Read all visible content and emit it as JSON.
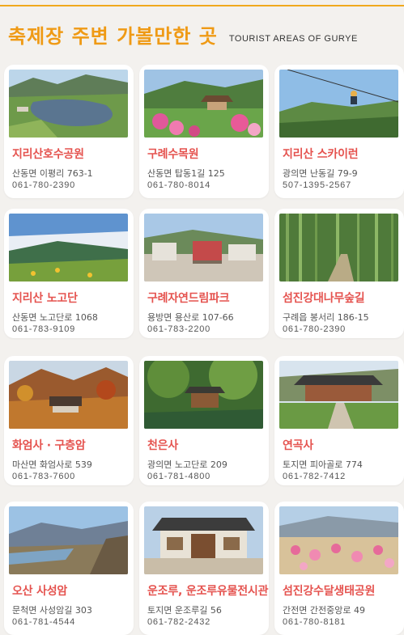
{
  "header": {
    "title": "축제장 주변 가볼만한 곳",
    "subtitle": "TOURIST AREAS OF GURYE"
  },
  "places": [
    {
      "name": "지리산호수공원",
      "address": "산동면 이평리 763-1",
      "phone": "061-780-2390"
    },
    {
      "name": "구례수목원",
      "address": "산동면 탑동1길 125",
      "phone": "061-780-8014"
    },
    {
      "name": "지리산 스카이런",
      "address": "광의면 난동길 79-9",
      "phone": "507-1395-2567"
    },
    {
      "name": "지리산 노고단",
      "address": "산동면 노고단로 1068",
      "phone": "061-783-9109"
    },
    {
      "name": "구례자연드림파크",
      "address": "용방면 용산로 107-66",
      "phone": "061-783-2200"
    },
    {
      "name": "섬진강대나무숲길",
      "address": "구례읍 봉서리 186-15",
      "phone": "061-780-2390"
    },
    {
      "name": "화엄사 · 구층암",
      "address": "마산면 화엄사로 539",
      "phone": "061-783-7600"
    },
    {
      "name": "천은사",
      "address": "광의면 노고단로 209",
      "phone": "061-781-4800"
    },
    {
      "name": "연곡사",
      "address": "토지면 피아골로 774",
      "phone": "061-782-7412"
    },
    {
      "name": "오산 사성암",
      "address": "문척면 사성암길 303",
      "phone": "061-781-4544"
    },
    {
      "name": "운조루, 운조루유물전시관",
      "address": "토지면 운조루길 56",
      "phone": "061-782-2432"
    },
    {
      "name": "섬진강수달생태공원",
      "address": "간전면 간전중앙로 49",
      "phone": "061-780-8181"
    }
  ]
}
